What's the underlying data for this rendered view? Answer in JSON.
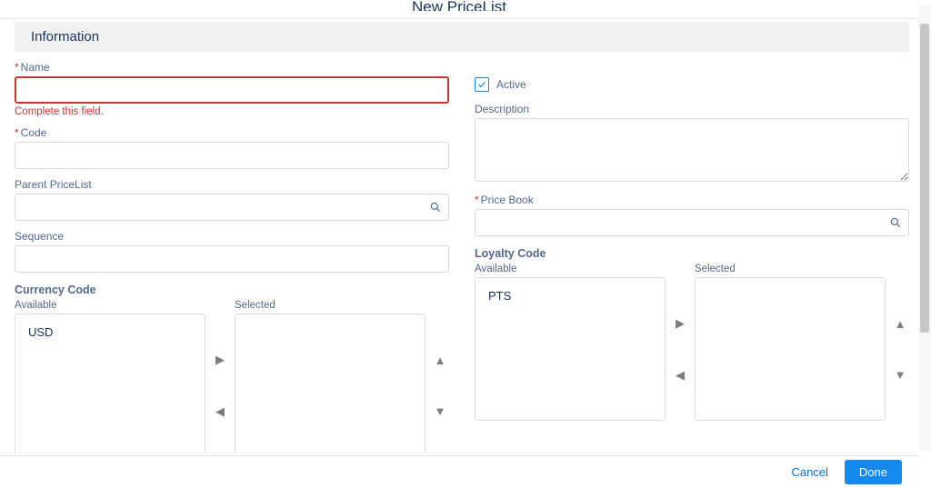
{
  "header": {
    "title": "New PriceList"
  },
  "section": {
    "title": "Information"
  },
  "fields": {
    "name": {
      "label": "Name",
      "value": "",
      "error": "Complete this field."
    },
    "code": {
      "label": "Code",
      "value": ""
    },
    "parent": {
      "label": "Parent PriceList",
      "value": ""
    },
    "sequence": {
      "label": "Sequence",
      "value": ""
    },
    "active": {
      "label": "Active",
      "checked": true
    },
    "description": {
      "label": "Description",
      "value": ""
    },
    "pricebook": {
      "label": "Price Book",
      "value": ""
    }
  },
  "currency": {
    "title": "Currency Code",
    "available_label": "Available",
    "selected_label": "Selected",
    "available": [
      "USD"
    ],
    "selected": []
  },
  "loyalty": {
    "title": "Loyalty Code",
    "available_label": "Available",
    "selected_label": "Selected",
    "available": [
      "PTS"
    ],
    "selected": []
  },
  "footer": {
    "cancel": "Cancel",
    "done": "Done"
  }
}
